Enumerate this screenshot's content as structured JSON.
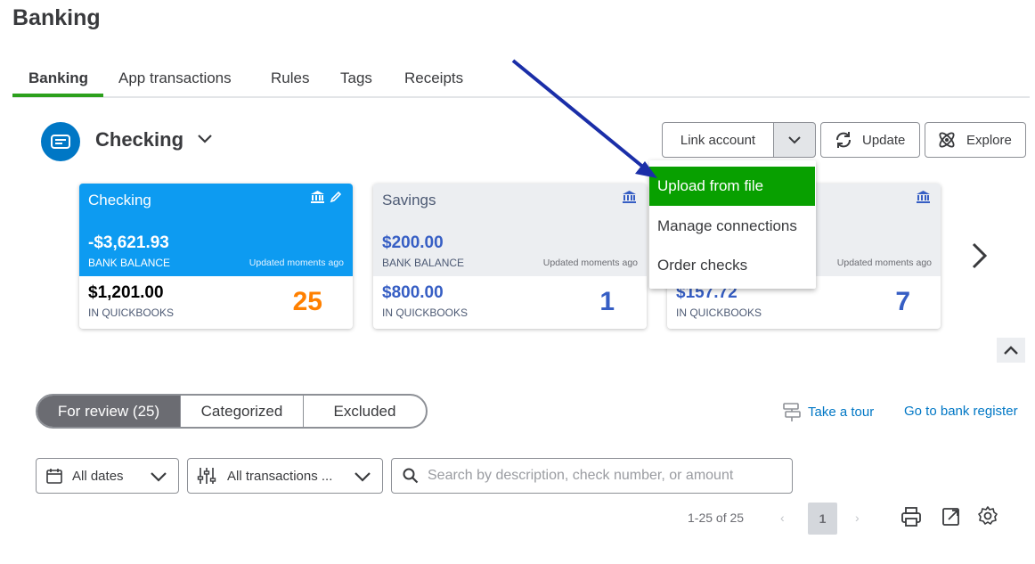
{
  "page": {
    "title": "Banking"
  },
  "tabs": [
    {
      "label": "Banking",
      "active": true
    },
    {
      "label": "App transactions"
    },
    {
      "label": "Rules"
    },
    {
      "label": "Tags"
    },
    {
      "label": "Receipts"
    }
  ],
  "account": {
    "name": "Checking",
    "icon": "bank-card-icon"
  },
  "actions": {
    "link_account": "Link account",
    "update": "Update",
    "explore": "Explore"
  },
  "dropdown": {
    "items": [
      "Upload from file",
      "Manage connections",
      "Order checks"
    ]
  },
  "cards": [
    {
      "name": "Checking",
      "bank_balance": "-$3,621.93",
      "bank_balance_label": "BANK BALANCE",
      "updated": "Updated moments ago",
      "qb_balance": "$1,201.00",
      "qb_label": "IN QUICKBOOKS",
      "count": "25",
      "selected": true
    },
    {
      "name": "Savings",
      "bank_balance": "$200.00",
      "bank_balance_label": "BANK BALANCE",
      "updated": "Updated moments ago",
      "qb_balance": "$800.00",
      "qb_label": "IN QUICKBOOKS",
      "count": "1"
    },
    {
      "name": "",
      "bank_balance": "",
      "bank_balance_label": "",
      "updated": "Updated moments ago",
      "qb_balance": "$157.72",
      "qb_label": "IN QUICKBOOKS",
      "count": "7"
    }
  ],
  "review_tabs": [
    "For review (25)",
    "Categorized",
    "Excluded"
  ],
  "links": {
    "tour": "Take a tour",
    "bank_register": "Go to bank register"
  },
  "filters": {
    "dates": "All dates",
    "transactions": "All transactions ...",
    "search_placeholder": "Search by description, check number, or amount"
  },
  "pager": {
    "range": "1-25 of 25",
    "prev": "‹",
    "page": "1",
    "next": "›"
  },
  "colors": {
    "brand_green": "#2ca01c",
    "highlight_green": "#08a000",
    "selected_card": "#0d9bf1",
    "link_blue": "#0077c5",
    "annotation_arrow": "#1a2ea8",
    "count_orange": "#ff8000"
  }
}
